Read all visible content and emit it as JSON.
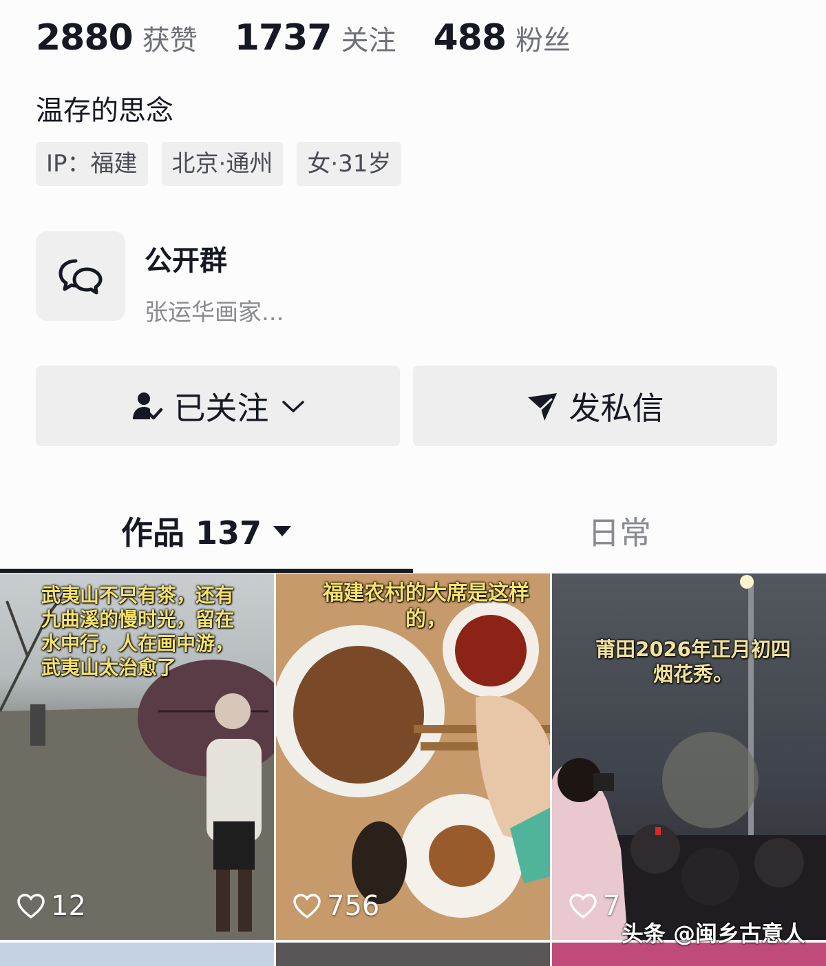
{
  "stats": [
    {
      "value": "2880",
      "label": "获赞"
    },
    {
      "value": "1737",
      "label": "关注"
    },
    {
      "value": "488",
      "label": "粉丝"
    }
  ],
  "bio": "温存的思念",
  "tags": [
    "IP：福建",
    "北京·通州",
    "女·31岁"
  ],
  "group": {
    "title": "公开群",
    "subtitle": "张运华画家..."
  },
  "actions": {
    "follow_label": "已关注",
    "message_label": "发私信"
  },
  "tabs": {
    "works_label": "作品 137",
    "daily_label": "日常"
  },
  "videos": [
    {
      "caption": "武夷山不只有茶，还有九曲溪的慢时光，留在水中行，人在画中游，武夷山太治愈了",
      "likes": "12"
    },
    {
      "caption": "福建农村的大席是这样的，",
      "likes": "756"
    },
    {
      "caption": "莆田2026年正月初四烟花秀。",
      "likes": "7"
    }
  ],
  "watermark": "头条 @闽乡古意人",
  "colors": {
    "accent": "#161823",
    "caption": "#f6e36a",
    "button_bg": "#eeeeef"
  }
}
